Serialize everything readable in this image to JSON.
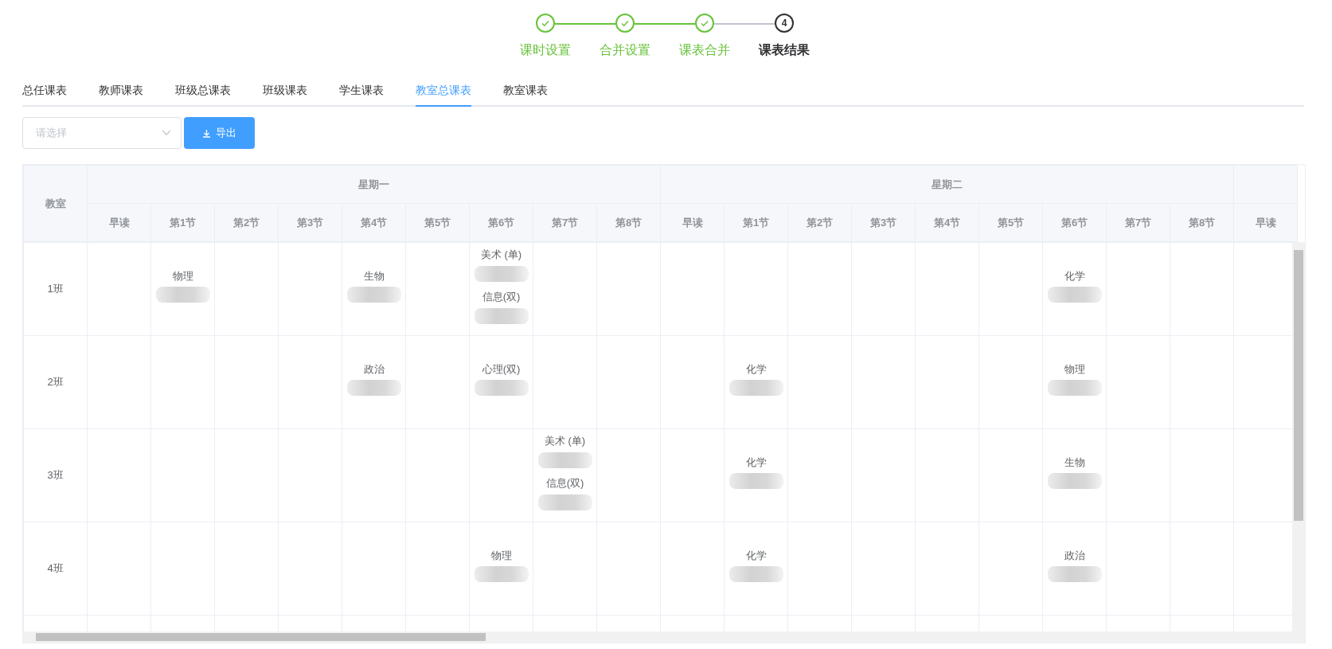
{
  "steps": [
    {
      "label": "课时设置",
      "done": true,
      "selected": false
    },
    {
      "label": "合并设置",
      "done": true,
      "selected": false
    },
    {
      "label": "课表合并",
      "done": true,
      "selected": false
    },
    {
      "label": "课表结果",
      "done": false,
      "selected": true,
      "number": "4"
    }
  ],
  "tabs": [
    {
      "label": "总任课表",
      "selected": false
    },
    {
      "label": "教师课表",
      "selected": false
    },
    {
      "label": "班级总课表",
      "selected": false
    },
    {
      "label": "班级课表",
      "selected": false
    },
    {
      "label": "学生课表",
      "selected": false
    },
    {
      "label": "教室总课表",
      "selected": true
    },
    {
      "label": "教室课表",
      "selected": false
    }
  ],
  "toolbar": {
    "select": {
      "placeholder": "请选择"
    },
    "export_button": "导出"
  },
  "table": {
    "room_header": "教室",
    "days": [
      {
        "label": "星期一",
        "periods": [
          "早读",
          "第1节",
          "第2节",
          "第3节",
          "第4节",
          "第5节",
          "第6节",
          "第7节",
          "第8节"
        ]
      },
      {
        "label": "星期二",
        "periods": [
          "早读",
          "第1节",
          "第2节",
          "第3节",
          "第4节",
          "第5节",
          "第6节",
          "第7节",
          "第8节"
        ]
      },
      {
        "periods": [
          "早读"
        ]
      }
    ],
    "rows": [
      {
        "room": "1班",
        "cells": [
          null,
          [
            {
              "subject": "物理"
            }
          ],
          null,
          null,
          [
            {
              "subject": "生物"
            }
          ],
          null,
          [
            {
              "subject": "美术 (单)"
            },
            {
              "subject": "信息(双)"
            }
          ],
          null,
          null,
          null,
          null,
          null,
          null,
          null,
          null,
          [
            {
              "subject": "化学"
            }
          ],
          null,
          null,
          null
        ]
      },
      {
        "room": "2班",
        "cells": [
          null,
          null,
          null,
          null,
          [
            {
              "subject": "政治"
            }
          ],
          null,
          [
            {
              "subject": "心理(双)"
            }
          ],
          null,
          null,
          null,
          [
            {
              "subject": "化学"
            }
          ],
          null,
          null,
          null,
          null,
          [
            {
              "subject": "物理"
            }
          ],
          null,
          null,
          null
        ]
      },
      {
        "room": "3班",
        "cells": [
          null,
          null,
          null,
          null,
          null,
          null,
          null,
          [
            {
              "subject": "美术 (单)"
            },
            {
              "subject": "信息(双)"
            }
          ],
          null,
          null,
          [
            {
              "subject": "化学"
            }
          ],
          null,
          null,
          null,
          null,
          [
            {
              "subject": "生物"
            }
          ],
          null,
          null,
          null
        ]
      },
      {
        "room": "4班",
        "cells": [
          null,
          null,
          null,
          null,
          null,
          null,
          [
            {
              "subject": "物理"
            }
          ],
          null,
          null,
          null,
          [
            {
              "subject": "化学"
            }
          ],
          null,
          null,
          null,
          null,
          [
            {
              "subject": "政治"
            }
          ],
          null,
          null,
          null
        ]
      }
    ]
  }
}
